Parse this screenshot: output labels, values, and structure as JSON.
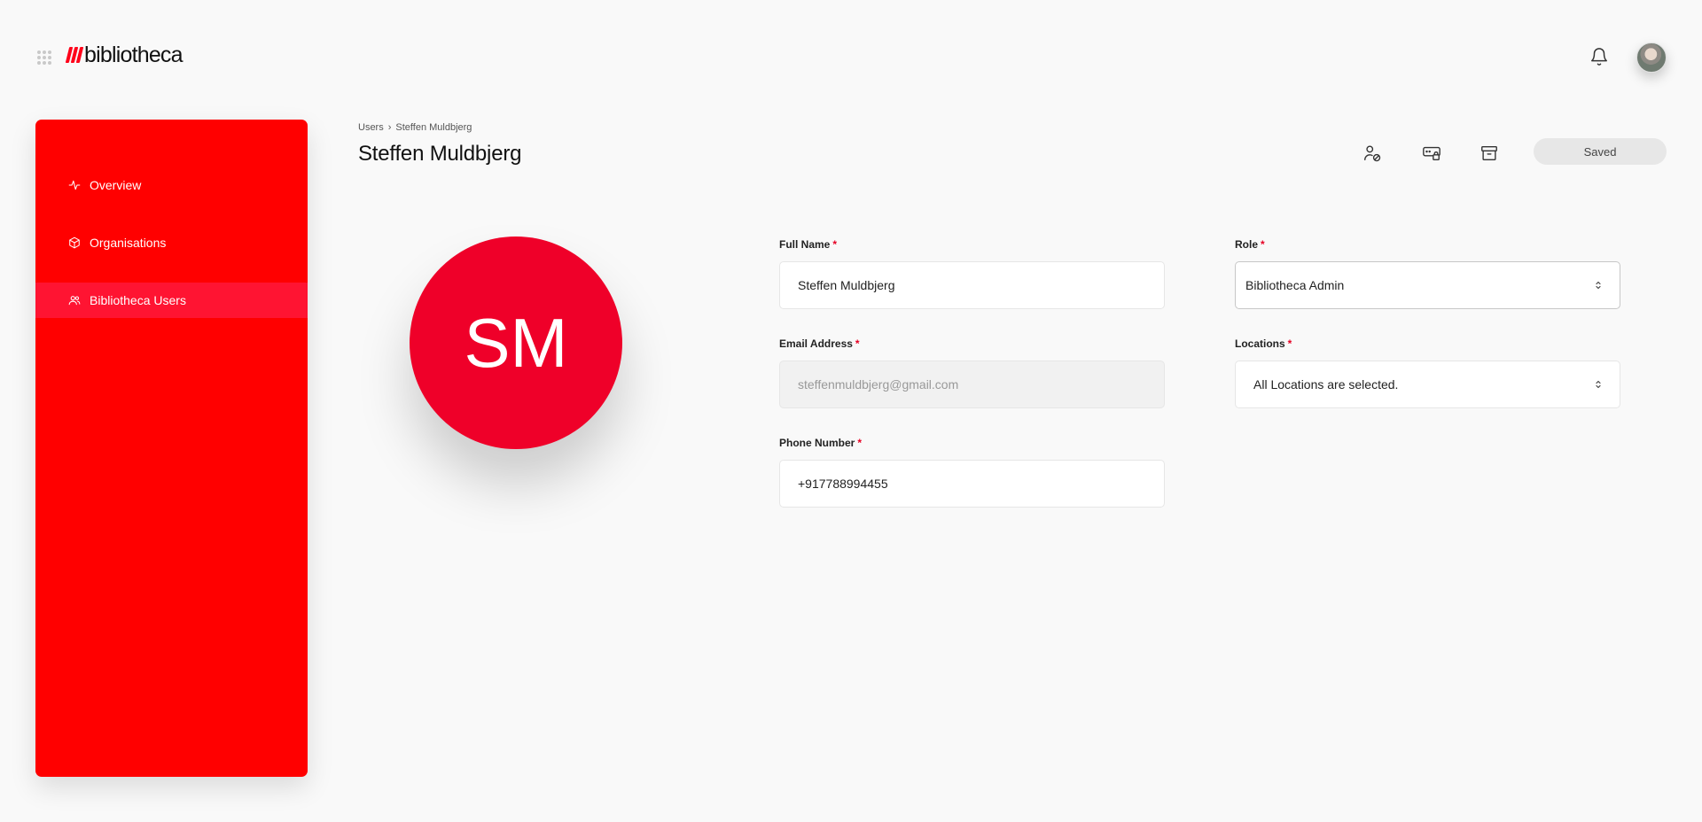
{
  "header": {
    "logo_text": "bibliotheca"
  },
  "sidebar": {
    "items": [
      {
        "label": "Overview",
        "icon": "activity-icon"
      },
      {
        "label": "Organisations",
        "icon": "box-icon"
      },
      {
        "label": "Bibliotheca Users",
        "icon": "users-icon",
        "active": true
      }
    ]
  },
  "breadcrumb": {
    "parent": "Users",
    "separator": "›",
    "current": "Steffen Muldbjerg"
  },
  "page": {
    "title": "Steffen Muldbjerg",
    "saved_label": "Saved",
    "initials": "SM"
  },
  "form": {
    "full_name": {
      "label": "Full Name",
      "value": "Steffen Muldbjerg"
    },
    "email": {
      "label": "Email Address",
      "value": "steffenmuldbjerg@gmail.com"
    },
    "phone": {
      "label": "Phone Number",
      "value": "+917788994455"
    },
    "role": {
      "label": "Role",
      "value": "Bibliotheca Admin"
    },
    "locations": {
      "label": "Locations",
      "value": "All Locations are selected."
    },
    "required_mark": "*"
  },
  "colors": {
    "brand": "#ff0000",
    "avatar_bg": "#ef0029",
    "required": "#e60023"
  }
}
